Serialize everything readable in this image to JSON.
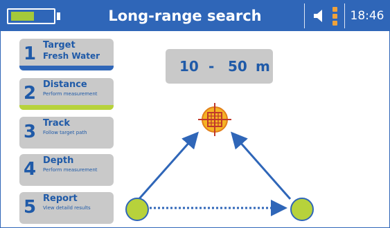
{
  "header": {
    "title": "Long-range search",
    "time": "18:46",
    "battery_level": 0.75,
    "battery_color": "#a4c93a",
    "signal_color": "#f0a23a",
    "speaker_icon": "speaker-icon"
  },
  "steps": [
    {
      "number": "1",
      "title": "Target",
      "subtitle": "Fresh Water",
      "bar_color": "#2f66b8"
    },
    {
      "number": "2",
      "title": "Distance",
      "subtitle": "Perform measurement",
      "bar_color": "#b7d23b"
    },
    {
      "number": "3",
      "title": "Track",
      "subtitle": "Follow target path"
    },
    {
      "number": "4",
      "title": "Depth",
      "subtitle": "Perform measurement"
    },
    {
      "number": "5",
      "title": "Report",
      "subtitle": "View detaild results"
    }
  ],
  "range": {
    "min": "10",
    "separator": "-",
    "max": "50",
    "unit": "m"
  },
  "colors": {
    "brand": "#2f66b8",
    "panel": "#c9c9c9",
    "target": "#f5b324",
    "crosshair": "#c0392b",
    "probe": "#b7d23b"
  }
}
